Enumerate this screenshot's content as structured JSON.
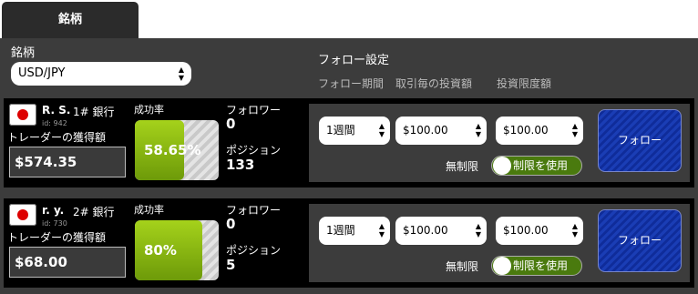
{
  "tab": {
    "label": "銘柄"
  },
  "symbol": {
    "label": "銘柄",
    "value": "USD/JPY"
  },
  "follow_settings": {
    "title": "フォロー設定",
    "col_period": "フォロー期間",
    "col_amount": "取引毎の投資額",
    "col_limit": "投資限度額"
  },
  "traders": [
    {
      "name": "R. S.",
      "rank": "1# 銀行",
      "id": "id: 942",
      "earnings_label": "トレーダーの獲得額",
      "earnings": "$574.35",
      "success_label": "成功率",
      "success": "58.65%",
      "success_fraction": 0.5865,
      "followers_label": "フォロワー",
      "followers": "0",
      "positions_label": "ポジション",
      "positions": "133",
      "period": "1週間",
      "amount": "$100.00",
      "limit": "$100.00",
      "unlimited_label": "無制限",
      "toggle_label": "制限を使用",
      "follow_button": "フォロー"
    },
    {
      "name": "r. y.",
      "rank": "2# 銀行",
      "id": "id: 730",
      "earnings_label": "トレーダーの獲得額",
      "earnings": "$68.00",
      "success_label": "成功率",
      "success": "80%",
      "success_fraction": 0.8,
      "followers_label": "フォロワー",
      "followers": "0",
      "positions_label": "ポジション",
      "positions": "5",
      "period": "1週間",
      "amount": "$100.00",
      "limit": "$100.00",
      "unlimited_label": "無制限",
      "toggle_label": "制限を使用",
      "follow_button": "フォロー"
    }
  ]
}
